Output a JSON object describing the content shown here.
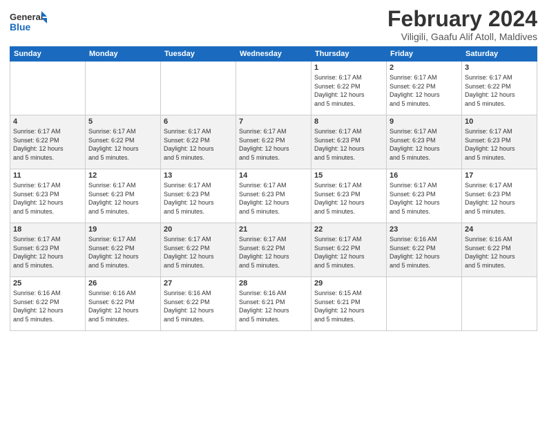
{
  "logo": {
    "line1": "General",
    "line2": "Blue"
  },
  "header": {
    "month": "February 2024",
    "location": "Viligili, Gaafu Alif Atoll, Maldives"
  },
  "weekdays": [
    "Sunday",
    "Monday",
    "Tuesday",
    "Wednesday",
    "Thursday",
    "Friday",
    "Saturday"
  ],
  "rows": [
    [
      {
        "day": "",
        "info": ""
      },
      {
        "day": "",
        "info": ""
      },
      {
        "day": "",
        "info": ""
      },
      {
        "day": "",
        "info": ""
      },
      {
        "day": "1",
        "info": "Sunrise: 6:17 AM\nSunset: 6:22 PM\nDaylight: 12 hours\nand 5 minutes."
      },
      {
        "day": "2",
        "info": "Sunrise: 6:17 AM\nSunset: 6:22 PM\nDaylight: 12 hours\nand 5 minutes."
      },
      {
        "day": "3",
        "info": "Sunrise: 6:17 AM\nSunset: 6:22 PM\nDaylight: 12 hours\nand 5 minutes."
      }
    ],
    [
      {
        "day": "4",
        "info": "Sunrise: 6:17 AM\nSunset: 6:22 PM\nDaylight: 12 hours\nand 5 minutes."
      },
      {
        "day": "5",
        "info": "Sunrise: 6:17 AM\nSunset: 6:22 PM\nDaylight: 12 hours\nand 5 minutes."
      },
      {
        "day": "6",
        "info": "Sunrise: 6:17 AM\nSunset: 6:22 PM\nDaylight: 12 hours\nand 5 minutes."
      },
      {
        "day": "7",
        "info": "Sunrise: 6:17 AM\nSunset: 6:22 PM\nDaylight: 12 hours\nand 5 minutes."
      },
      {
        "day": "8",
        "info": "Sunrise: 6:17 AM\nSunset: 6:23 PM\nDaylight: 12 hours\nand 5 minutes."
      },
      {
        "day": "9",
        "info": "Sunrise: 6:17 AM\nSunset: 6:23 PM\nDaylight: 12 hours\nand 5 minutes."
      },
      {
        "day": "10",
        "info": "Sunrise: 6:17 AM\nSunset: 6:23 PM\nDaylight: 12 hours\nand 5 minutes."
      }
    ],
    [
      {
        "day": "11",
        "info": "Sunrise: 6:17 AM\nSunset: 6:23 PM\nDaylight: 12 hours\nand 5 minutes."
      },
      {
        "day": "12",
        "info": "Sunrise: 6:17 AM\nSunset: 6:23 PM\nDaylight: 12 hours\nand 5 minutes."
      },
      {
        "day": "13",
        "info": "Sunrise: 6:17 AM\nSunset: 6:23 PM\nDaylight: 12 hours\nand 5 minutes."
      },
      {
        "day": "14",
        "info": "Sunrise: 6:17 AM\nSunset: 6:23 PM\nDaylight: 12 hours\nand 5 minutes."
      },
      {
        "day": "15",
        "info": "Sunrise: 6:17 AM\nSunset: 6:23 PM\nDaylight: 12 hours\nand 5 minutes."
      },
      {
        "day": "16",
        "info": "Sunrise: 6:17 AM\nSunset: 6:23 PM\nDaylight: 12 hours\nand 5 minutes."
      },
      {
        "day": "17",
        "info": "Sunrise: 6:17 AM\nSunset: 6:23 PM\nDaylight: 12 hours\nand 5 minutes."
      }
    ],
    [
      {
        "day": "18",
        "info": "Sunrise: 6:17 AM\nSunset: 6:23 PM\nDaylight: 12 hours\nand 5 minutes."
      },
      {
        "day": "19",
        "info": "Sunrise: 6:17 AM\nSunset: 6:22 PM\nDaylight: 12 hours\nand 5 minutes."
      },
      {
        "day": "20",
        "info": "Sunrise: 6:17 AM\nSunset: 6:22 PM\nDaylight: 12 hours\nand 5 minutes."
      },
      {
        "day": "21",
        "info": "Sunrise: 6:17 AM\nSunset: 6:22 PM\nDaylight: 12 hours\nand 5 minutes."
      },
      {
        "day": "22",
        "info": "Sunrise: 6:17 AM\nSunset: 6:22 PM\nDaylight: 12 hours\nand 5 minutes."
      },
      {
        "day": "23",
        "info": "Sunrise: 6:16 AM\nSunset: 6:22 PM\nDaylight: 12 hours\nand 5 minutes."
      },
      {
        "day": "24",
        "info": "Sunrise: 6:16 AM\nSunset: 6:22 PM\nDaylight: 12 hours\nand 5 minutes."
      }
    ],
    [
      {
        "day": "25",
        "info": "Sunrise: 6:16 AM\nSunset: 6:22 PM\nDaylight: 12 hours\nand 5 minutes."
      },
      {
        "day": "26",
        "info": "Sunrise: 6:16 AM\nSunset: 6:22 PM\nDaylight: 12 hours\nand 5 minutes."
      },
      {
        "day": "27",
        "info": "Sunrise: 6:16 AM\nSunset: 6:22 PM\nDaylight: 12 hours\nand 5 minutes."
      },
      {
        "day": "28",
        "info": "Sunrise: 6:16 AM\nSunset: 6:21 PM\nDaylight: 12 hours\nand 5 minutes."
      },
      {
        "day": "29",
        "info": "Sunrise: 6:15 AM\nSunset: 6:21 PM\nDaylight: 12 hours\nand 5 minutes."
      },
      {
        "day": "",
        "info": ""
      },
      {
        "day": "",
        "info": ""
      }
    ]
  ]
}
